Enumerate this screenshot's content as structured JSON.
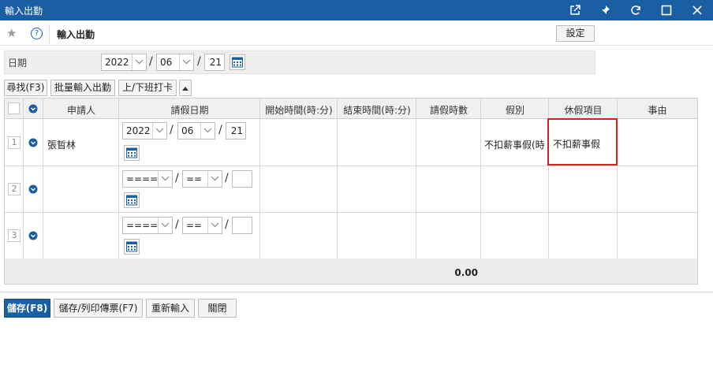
{
  "window": {
    "title": "輸入出勤"
  },
  "toolbar": {
    "page_title": "輸入出勤",
    "settings_label": "設定"
  },
  "filter": {
    "date_label": "日期",
    "year": "2022",
    "month": "06",
    "day": "21",
    "sep1": "/",
    "sep2": "/"
  },
  "actions": {
    "find": "尋找(F3)",
    "batch": "批量輸入出勤",
    "punch": "上/下班打卡"
  },
  "table": {
    "headers": {
      "applicant": "申請人",
      "leave_date": "請假日期",
      "start_time": "開始時間(時:分)",
      "end_time": "結束時間(時:分)",
      "hours": "請假時數",
      "leave_type": "假別",
      "leave_item": "休假項目",
      "reason": "事由"
    },
    "rows": [
      {
        "num": "1",
        "applicant": "張晢林",
        "year": "2022",
        "month": "06",
        "day": "21",
        "leave_type": "不扣薪事假(時",
        "leave_item": "不扣薪事假"
      },
      {
        "num": "2",
        "applicant": "",
        "year": "====",
        "month": "==",
        "day": "",
        "leave_type": "",
        "leave_item": ""
      },
      {
        "num": "3",
        "applicant": "",
        "year": "====",
        "month": "==",
        "day": "",
        "leave_type": "",
        "leave_item": ""
      }
    ],
    "date_sep": "/",
    "total_hours": "0.00"
  },
  "footer": {
    "save": "儲存(F8)",
    "save_print": "儲存/列印傳票(F7)",
    "reenter": "重新輸入",
    "close": "關閉"
  },
  "colors": {
    "titlebar": "#1a5fa3",
    "highlight": "#d9201d"
  }
}
